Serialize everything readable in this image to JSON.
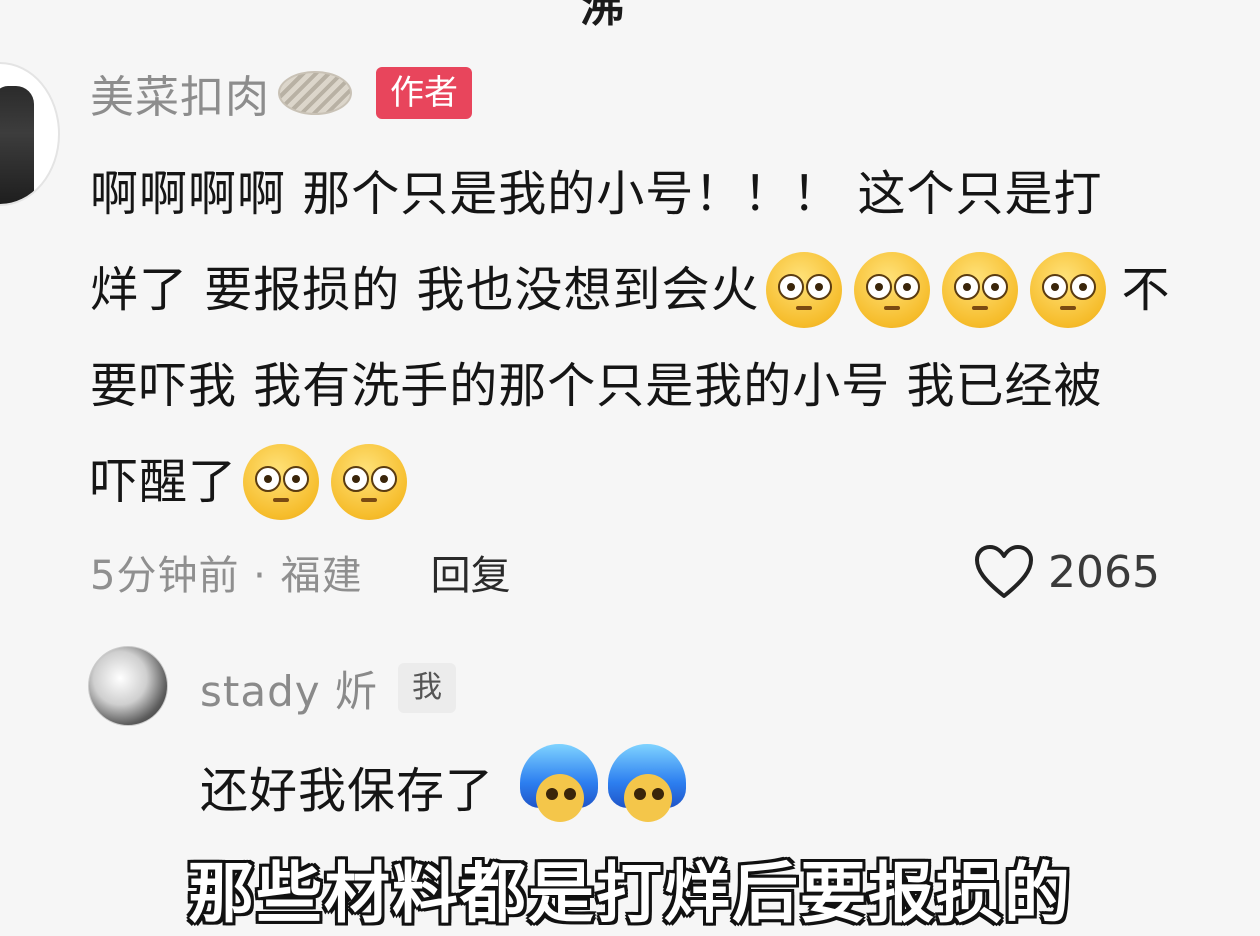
{
  "top_partial_text": "沸",
  "comment": {
    "username": "美菜扣肉",
    "author_tag": "作者",
    "lines": [
      "啊啊啊啊 那个只是我的小号！！！ 这个只是打",
      "烊了 要报损的 我也没想到会火",
      "要吓我 我有洗手的那个只是我的小号 我已经被",
      "吓醒了"
    ],
    "line2_tail": "不",
    "meta": "5分钟前 · 福建",
    "reply_label": "回复",
    "likes": "2065"
  },
  "reply": {
    "username": "stady 炘",
    "me_tag": "我",
    "text": "还好我保存了"
  },
  "subtitle": "那些材料都是打烊后要报损的",
  "icons": {
    "flushed_emoji": "flushed-face-emoji",
    "blue_hair_sticker": "blue-hair-sticker",
    "like": "heart-outline-icon"
  },
  "colors": {
    "author_tag_bg": "#e8455c",
    "meta_text": "#8f8f8f"
  }
}
